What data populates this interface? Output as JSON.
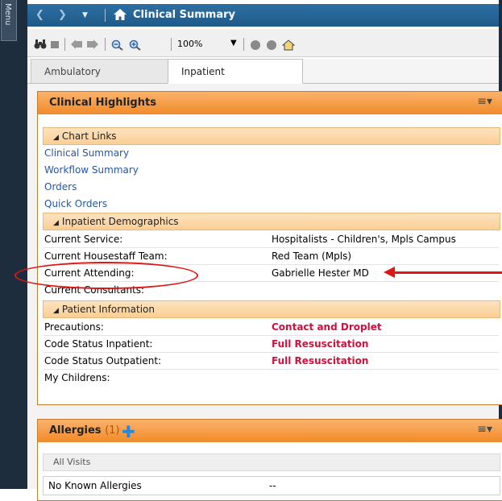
{
  "sidebar": {
    "menu_label": "Menu"
  },
  "titlebar": {
    "title": "Clinical Summary"
  },
  "toolbar": {
    "zoom": "100%"
  },
  "tabs": [
    {
      "label": "Ambulatory"
    },
    {
      "label": "Inpatient"
    }
  ],
  "clinical_highlights": {
    "title": "Clinical Highlights",
    "chart_links": {
      "header": "Chart Links",
      "links": [
        "Clinical Summary",
        "Workflow Summary",
        "Orders",
        "Quick Orders"
      ]
    },
    "demographics": {
      "header": "Inpatient Demographics",
      "rows": [
        {
          "label": "Current Service:",
          "value": "Hospitalists - Children's, Mpls Campus"
        },
        {
          "label": "Current Housestaff Team:",
          "value": "Red Team (Mpls)"
        },
        {
          "label": "Current Attending:",
          "value": "Gabrielle Hester MD"
        },
        {
          "label": "Current Consultants:",
          "value": ""
        }
      ]
    },
    "patient_info": {
      "header": "Patient Information",
      "rows": [
        {
          "label": "Precautions:",
          "value": "Contact and Droplet"
        },
        {
          "label": "Code Status Inpatient:",
          "value": "Full Resuscitation"
        },
        {
          "label": "Code Status Outpatient:",
          "value": "Full Resuscitation"
        },
        {
          "label": "My Childrens:",
          "value": ""
        }
      ]
    }
  },
  "allergies": {
    "title": "Allergies",
    "count": "(1)",
    "subheader": "All Visits",
    "row": {
      "name": "No Known Allergies",
      "value": "--"
    }
  },
  "colors": {
    "accent_orange": "#f08a2a",
    "titlebar_blue": "#1f5a88",
    "alert_red": "#d0103a",
    "link_blue": "#2657a0"
  }
}
